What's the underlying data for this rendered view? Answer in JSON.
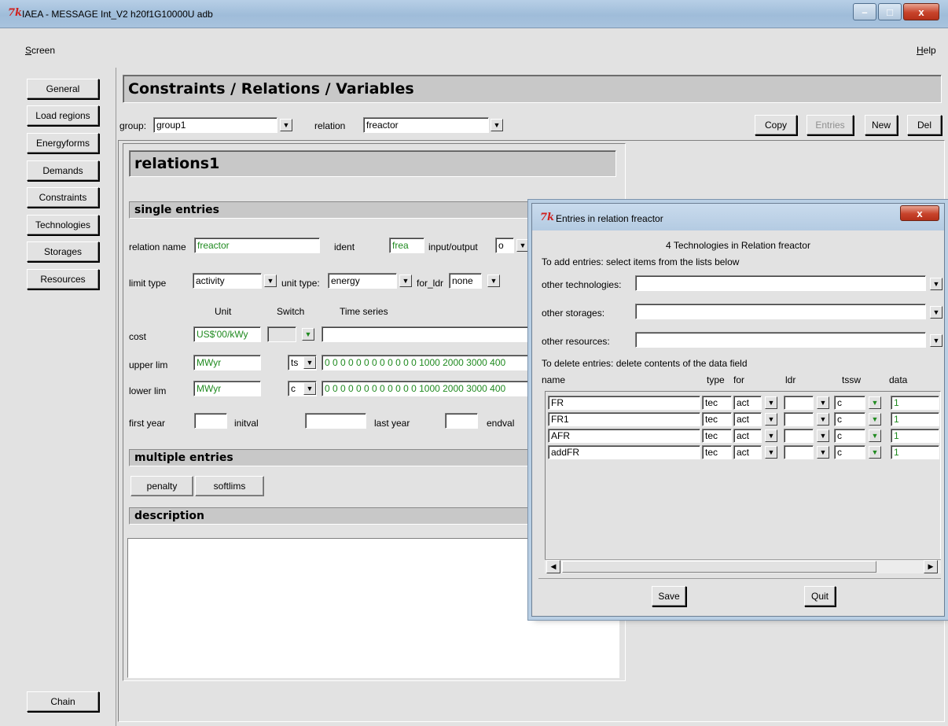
{
  "window": {
    "title": "IAEA - MESSAGE Int_V2 h20f1G10000U adb",
    "logo": "7k",
    "controls": {
      "minimize": "–",
      "maximize": "□",
      "close": "x"
    }
  },
  "menu": {
    "screen_first": "S",
    "screen_rest": "creen",
    "help_first": "H",
    "help_rest": "elp"
  },
  "sidebar": {
    "items": [
      "General",
      "Load regions",
      "Energyforms",
      "Demands",
      "Constraints",
      "Technologies",
      "Storages",
      "Resources"
    ],
    "chain": "Chain"
  },
  "main": {
    "title": "Constraints / Relations / Variables",
    "group_label": "group:",
    "group_value": "group1",
    "relation_label": "relation",
    "relation_value": "freactor",
    "buttons": {
      "copy": "Copy",
      "entries": "Entries",
      "new": "New",
      "del": "Del"
    }
  },
  "relation": {
    "header": "relations1",
    "single_entries": "single entries",
    "name_label": "relation name",
    "name_value": "freactor",
    "ident_label": "ident",
    "ident_value": "frea",
    "io_label": "input/output",
    "io_value": "o",
    "limit_type_label": "limit type",
    "limit_type_value": "activity",
    "unit_type_label": "unit type:",
    "unit_type_value": "energy",
    "for_ldr_label": "for_ldr",
    "for_ldr_value": "none",
    "col_unit": "Unit",
    "col_switch": "Switch",
    "col_time_series": "Time series",
    "cost_label": "cost",
    "cost_unit": "US$'00/kWy",
    "cost_switch": "",
    "cost_series": "",
    "upper_label": "upper lim",
    "upper_unit": "MWyr",
    "upper_switch": "ts",
    "upper_series": "0 0 0 0 0 0 0 0 0 0 0 0 1000 2000 3000 400",
    "lower_label": "lower lim",
    "lower_unit": "MWyr",
    "lower_switch": "c",
    "lower_series": "0 0 0 0 0 0 0 0 0 0 0 0 1000 2000 3000 400",
    "first_year_label": "first year",
    "initval_label": "initval",
    "last_year_label": "last year",
    "endval_label": "endval",
    "multiple_entries": "multiple entries",
    "penalty": "penalty",
    "softlims": "softlims",
    "description": "description"
  },
  "dialog": {
    "title": "Entries in relation freactor",
    "summary": "4 Technologies in Relation freactor",
    "add_hint": "To add entries: select items from the lists below",
    "other_technologies": "other technologies:",
    "other_storages": "other storages:",
    "other_resources": "other resources:",
    "delete_hint": "To delete entries: delete contents of the data field",
    "columns": [
      "name",
      "type",
      "for",
      "ldr",
      "tssw",
      "data"
    ],
    "rows": [
      {
        "name": "FR",
        "type": "tec",
        "for": "act",
        "ldr": "",
        "tssw": "c",
        "data": "1"
      },
      {
        "name": "FR1",
        "type": "tec",
        "for": "act",
        "ldr": "",
        "tssw": "c",
        "data": "1"
      },
      {
        "name": "AFR",
        "type": "tec",
        "for": "act",
        "ldr": "",
        "tssw": "c",
        "data": "1"
      },
      {
        "name": "addFR",
        "type": "tec",
        "for": "act",
        "ldr": "",
        "tssw": "c",
        "data": "1"
      }
    ],
    "save": "Save",
    "quit": "Quit"
  },
  "icons": {
    "dropdown": "▼",
    "scroll_left": "◀",
    "scroll_right": "▶"
  }
}
